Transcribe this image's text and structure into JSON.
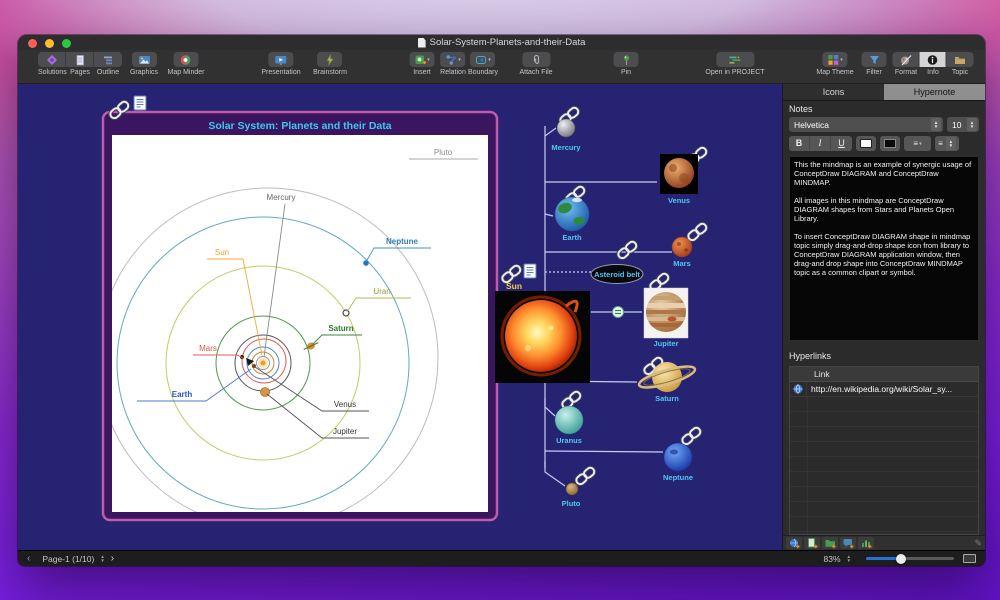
{
  "window": {
    "title": "Solar-System-Planets-and-their-Data"
  },
  "toolbar": {
    "solutions": "Solutions",
    "pages": "Pages",
    "outline": "Outline",
    "graphics": "Graphics",
    "map_minder": "Map Minder",
    "presentation": "Presentation",
    "brainstorm": "Brainstorm",
    "insert": "Insert",
    "relation": "Relation",
    "boundary": "Boundary",
    "attach_file": "Attach File",
    "pin": "Pin",
    "open_in_project": "Open in PROJECT",
    "map_theme": "Map Theme",
    "filter": "Filter",
    "format": "Format",
    "info": "Info",
    "topic": "Topic"
  },
  "panel": {
    "tabs": {
      "icons": "Icons",
      "hypernote": "Hypernote"
    },
    "notes": {
      "label": "Notes",
      "font": "Helvetica",
      "size": "10",
      "bold": "B",
      "italic": "I",
      "underline": "U",
      "text": "This the mindmap is an example of synergic usage of ConceptDraw DIAGRAM and ConceptDraw MINDMAP.\n\nAll images in this mindmap are ConceptDraw DIAGRAM shapes from Stars and Planets Open Library.\n\nTo insert ConceptDraw DIAGRAM shape in mindmap topic simply drag-and-drop shape icon from library to ConceptDraw DIAGRAM application window, then drag-and drop shape into ConceptDraw MINDMAP topic as a common clipart or symbol."
    },
    "hyperlinks": {
      "label": "Hyperlinks",
      "column": "Link",
      "url": "http://en.wikipedia.org/wiki/Solar_sy..."
    }
  },
  "statusbar": {
    "page": "Page-1 (1/10)",
    "zoom": "83%"
  },
  "diagram": {
    "title": "Solar System: Planets and their Data",
    "labels": {
      "pluto": "Pluto",
      "mercury": "Mercury",
      "sun": "Sun",
      "neptune": "Neptune",
      "uran": "Uran",
      "saturn": "Saturn",
      "mars": "Mars",
      "earth": "Earth",
      "venus": "Venus",
      "jupiter": "Jupiter"
    }
  },
  "mindmap": {
    "topics": {
      "mercury": "Mercury",
      "venus": "Venus",
      "earth": "Earth",
      "mars": "Mars",
      "asteroid_belt": "Asteroid belt",
      "sun": "Sun",
      "jupiter": "Jupiter",
      "saturn": "Saturn",
      "uranus": "Uranus",
      "neptune": "Neptune",
      "pluto": "Pluto"
    }
  },
  "colors": {
    "accent_cyan": "#4fc8f2",
    "title_cyan": "#3ec8f0",
    "frame_magenta": "#c05aaa",
    "canvas_navy": "#262373",
    "sun_label_yellow": "#f0d040",
    "slider_blue": "#2a6fd4"
  }
}
